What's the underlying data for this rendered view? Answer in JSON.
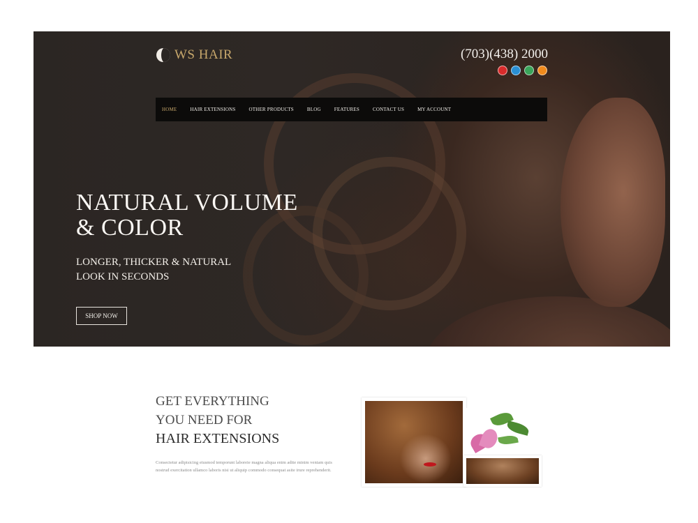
{
  "brand": {
    "name": "WS HAIR",
    "accent_color": "#c7a76b"
  },
  "header": {
    "phone": "(703)(438) 2000",
    "social_icons": [
      "youtube-icon",
      "twitter-icon",
      "stumbleupon-icon",
      "rss-icon"
    ]
  },
  "nav": {
    "items": [
      {
        "label": "HOME",
        "active": true
      },
      {
        "label": "HAIR EXTENSIONS"
      },
      {
        "label": "OTHER PRODUCTS"
      },
      {
        "label": "BLOG"
      },
      {
        "label": "FEATURES"
      },
      {
        "label": "CONTACT US"
      },
      {
        "label": "MY ACCOUNT"
      }
    ]
  },
  "hero": {
    "headline_line1": "NATURAL VOLUME",
    "headline_line2": "& COLOR",
    "sub_line1": "LONGER, THICKER & NATURAL",
    "sub_line2": "LOOK IN SECONDS",
    "cta_label": "SHOP NOW"
  },
  "intro": {
    "line1": "GET EVERYTHING",
    "line2": "YOU NEED FOR",
    "line3": "HAIR EXTENSIONS",
    "body": "Consectetur adipisicing eiusmod temporunt laboreie magna aliqua enim adite minim veniam quis nostrud exercitation ullamco laboris nisi ut aliquip commodo consequat asite irure reprehenderit."
  }
}
